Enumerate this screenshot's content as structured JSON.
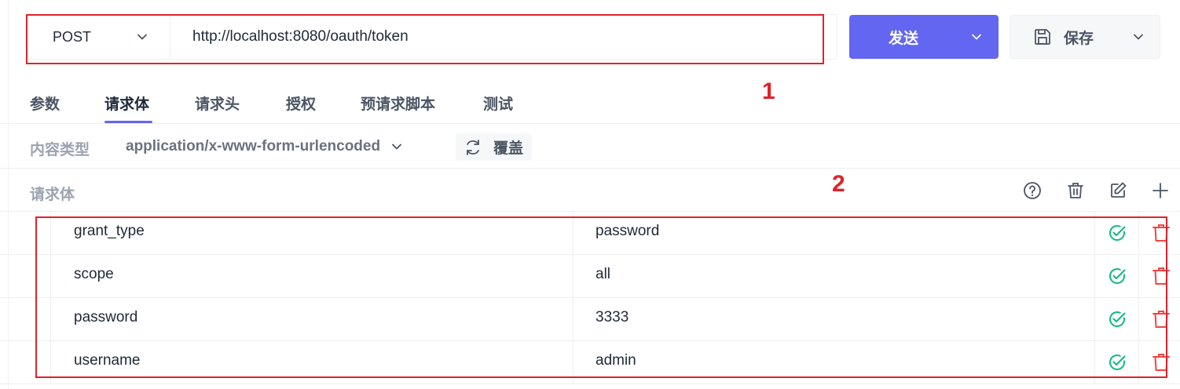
{
  "request": {
    "method": "POST",
    "url": "http://localhost:8080/oauth/token",
    "send_label": "发送",
    "save_label": "保存"
  },
  "tabs": [
    {
      "label": "参数",
      "active": false
    },
    {
      "label": "请求体",
      "active": true
    },
    {
      "label": "请求头",
      "active": false
    },
    {
      "label": "授权",
      "active": false
    },
    {
      "label": "预请求脚本",
      "active": false
    },
    {
      "label": "测试",
      "active": false
    }
  ],
  "content_type": {
    "label": "内容类型",
    "value": "application/x-www-form-urlencoded",
    "override_label": "覆盖"
  },
  "body": {
    "label": "请求体",
    "rows": [
      {
        "key": "grant_type",
        "value": "password"
      },
      {
        "key": "scope",
        "value": "all"
      },
      {
        "key": "password",
        "value": "3333"
      },
      {
        "key": "username",
        "value": "admin"
      }
    ]
  },
  "annotations": [
    "1",
    "2"
  ],
  "colors": {
    "accent": "#6366f1",
    "annotation": "#e0222a",
    "enabled": "#10b981",
    "delete": "#ef4444"
  }
}
